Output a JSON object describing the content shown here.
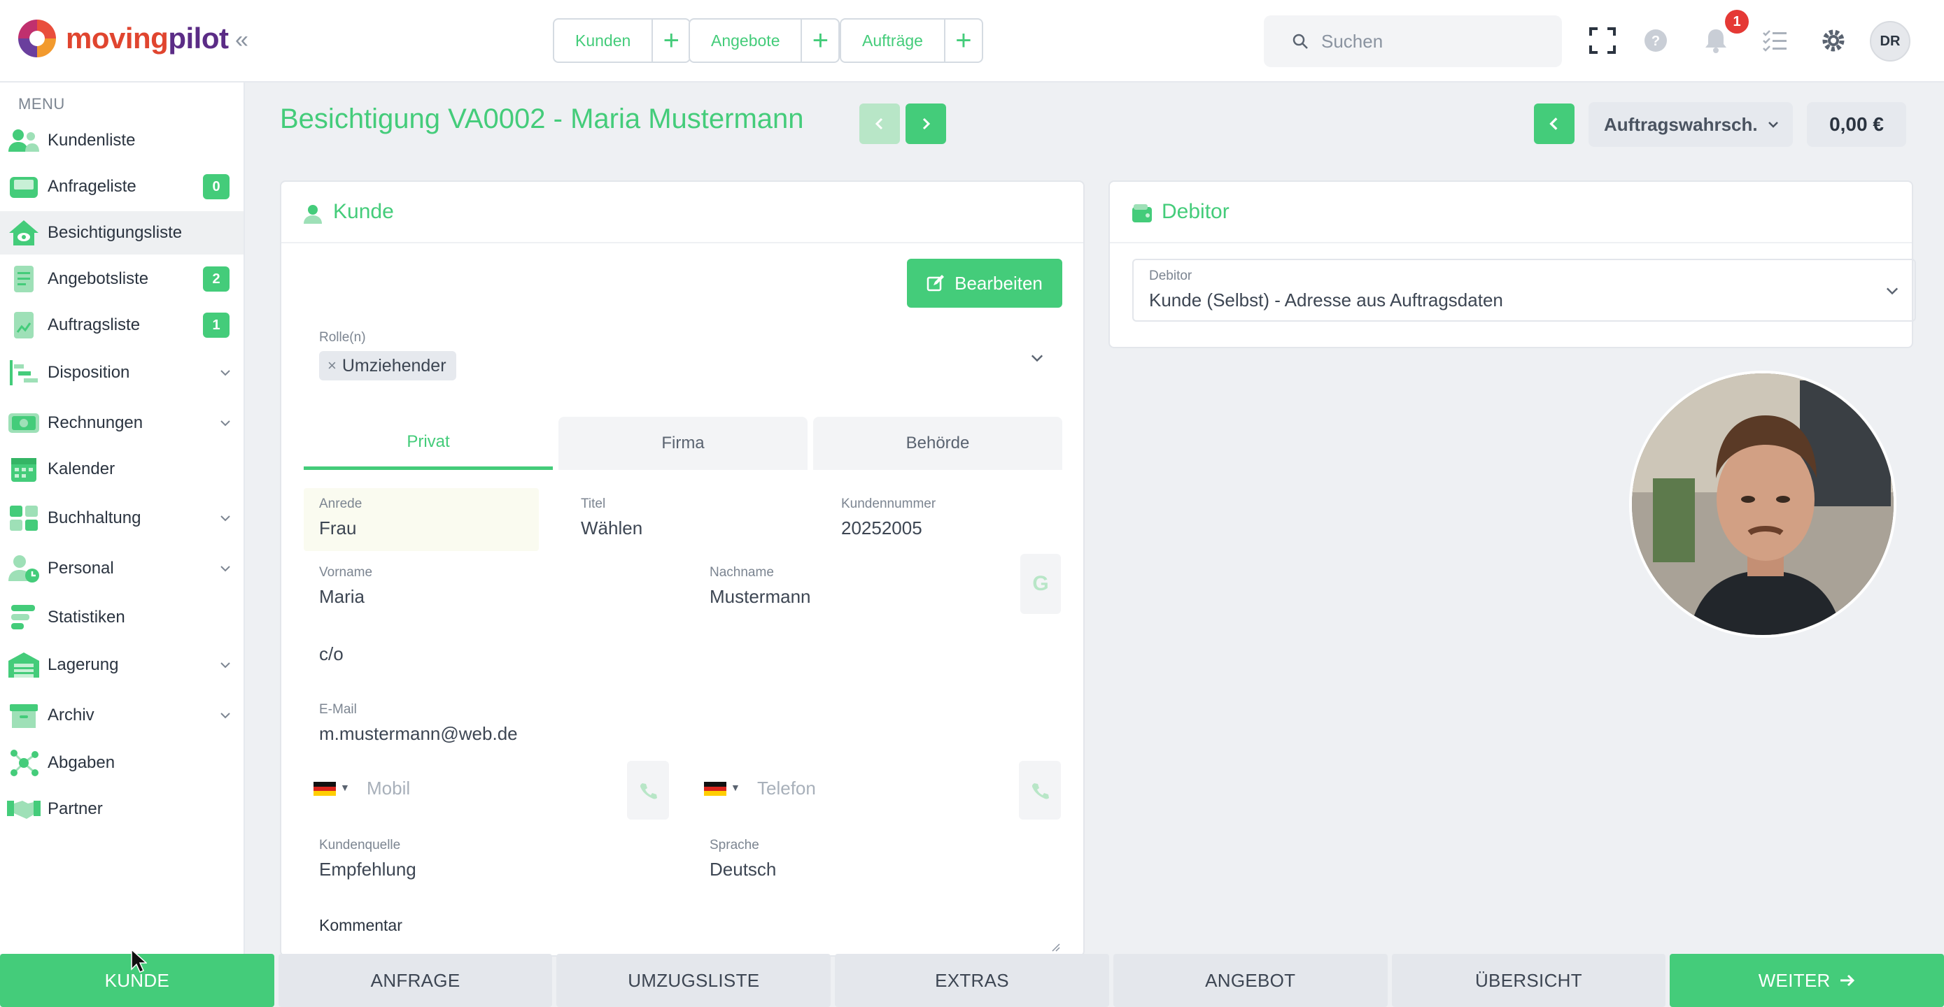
{
  "app": {
    "logo_part1": "moving",
    "logo_part2": "pilot"
  },
  "topbar": {
    "quick": [
      {
        "label": "Kunden"
      },
      {
        "label": "Angebote"
      },
      {
        "label": "Aufträge"
      }
    ],
    "search_placeholder": "Suchen",
    "notification_count": "1",
    "avatar": "DR"
  },
  "sidebar": {
    "title": "MENU",
    "items": [
      {
        "label": "Kundenliste"
      },
      {
        "label": "Anfrageliste",
        "badge": "0"
      },
      {
        "label": "Besichtigungsliste"
      },
      {
        "label": "Angebotsliste",
        "badge": "2"
      },
      {
        "label": "Auftragsliste",
        "badge": "1"
      },
      {
        "label": "Disposition"
      },
      {
        "label": "Rechnungen"
      },
      {
        "label": "Kalender"
      },
      {
        "label": "Buchhaltung"
      },
      {
        "label": "Personal"
      },
      {
        "label": "Statistiken"
      },
      {
        "label": "Lagerung"
      },
      {
        "label": "Archiv"
      },
      {
        "label": "Abgaben"
      },
      {
        "label": "Partner"
      }
    ]
  },
  "header": {
    "title": "Besichtigung VA0002 - Maria Mustermann",
    "probability_label": "Auftragswahrsch.",
    "amount": "0,00 €"
  },
  "kunde": {
    "title": "Kunde",
    "edit_label": "Bearbeiten",
    "roles_label": "Rolle(n)",
    "role_chip": "Umziehender",
    "tabs": [
      "Privat",
      "Firma",
      "Behörde"
    ],
    "anrede_label": "Anrede",
    "anrede_value": "Frau",
    "titel_label": "Titel",
    "titel_value": "Wählen",
    "kundennummer_label": "Kundennummer",
    "kundennummer_value": "20252005",
    "vorname_label": "Vorname",
    "vorname_value": "Maria",
    "nachname_label": "Nachname",
    "nachname_value": "Mustermann",
    "google_label": "G",
    "co_label": "c/o",
    "email_label": "E-Mail",
    "email_value": "m.mustermann@web.de",
    "mobil_placeholder": "Mobil",
    "telefon_placeholder": "Telefon",
    "kundenquelle_label": "Kundenquelle",
    "kundenquelle_value": "Empfehlung",
    "sprache_label": "Sprache",
    "sprache_value": "Deutsch",
    "kommentar_label": "Kommentar"
  },
  "debitor": {
    "title": "Debitor",
    "field_label": "Debitor",
    "field_value": "Kunde (Selbst) - Adresse aus Auftragsdaten"
  },
  "steps": [
    "KUNDE",
    "ANFRAGE",
    "UMZUGSLISTE",
    "EXTRAS",
    "ANGEBOT",
    "ÜBERSICHT",
    "WEITER"
  ],
  "colors": {
    "accent": "#44cc7a",
    "badge_red": "#e53935"
  }
}
